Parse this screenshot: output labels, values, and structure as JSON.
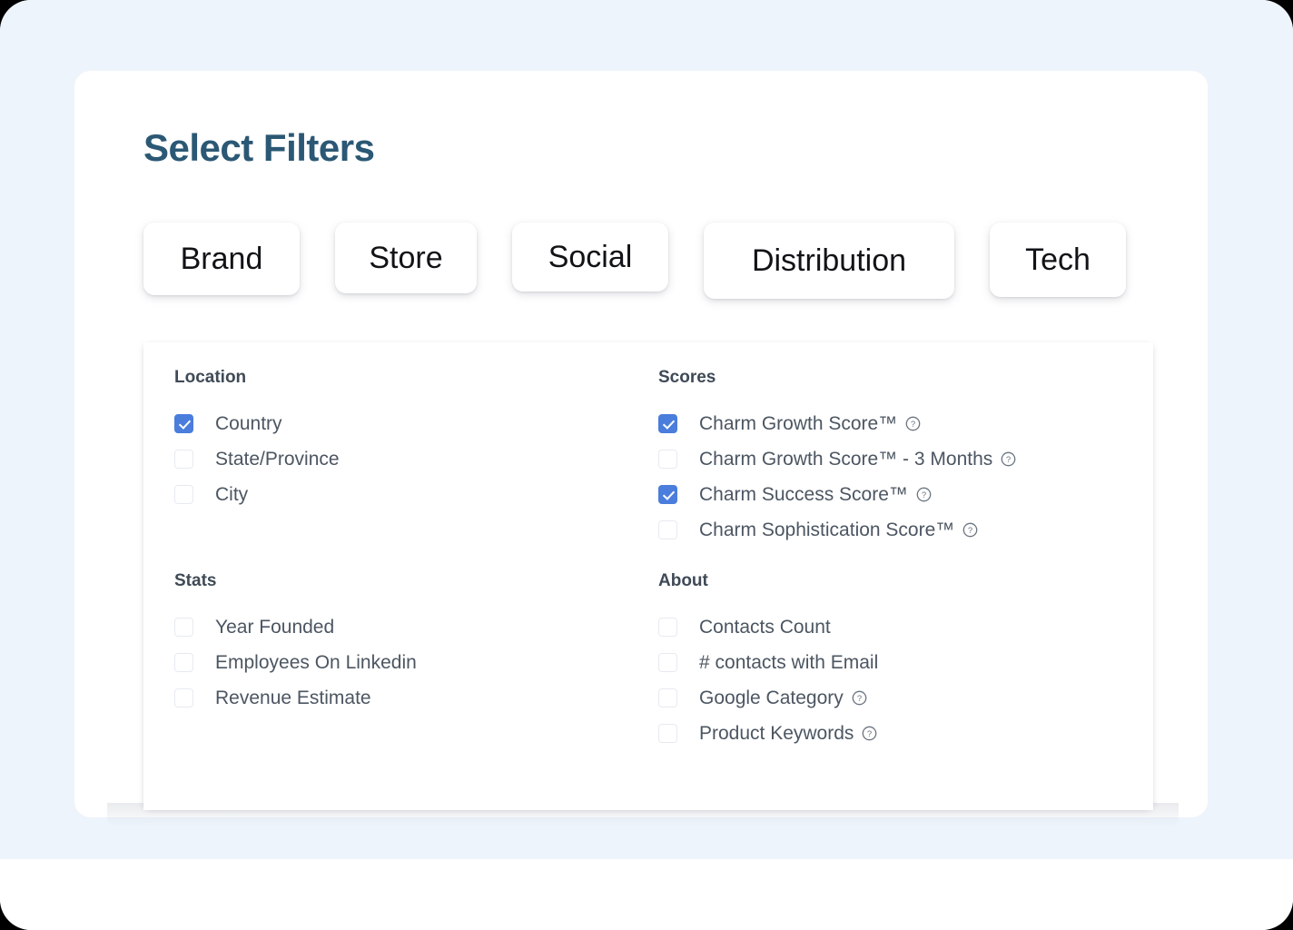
{
  "page": {
    "title": "Select Filters",
    "accent_color": "#2b5874",
    "checkbox_checked_color": "#4a7ddc",
    "background_color": "#eef4fc",
    "card_color": "#ffffff"
  },
  "tabs": [
    {
      "label": "Brand",
      "key": "brand"
    },
    {
      "label": "Store",
      "key": "store"
    },
    {
      "label": "Social",
      "key": "social"
    },
    {
      "label": "Distribution",
      "key": "distribution"
    },
    {
      "label": "Tech",
      "key": "tech"
    }
  ],
  "groups": {
    "location": {
      "title": "Location",
      "options": [
        {
          "label": "Country",
          "checked": true,
          "help": false
        },
        {
          "label": "State/Province",
          "checked": false,
          "help": false
        },
        {
          "label": "City",
          "checked": false,
          "help": false
        }
      ]
    },
    "scores": {
      "title": "Scores",
      "options": [
        {
          "label": "Charm Growth Score™",
          "checked": true,
          "help": true
        },
        {
          "label": "Charm Growth Score™ - 3 Months",
          "checked": false,
          "help": true
        },
        {
          "label": "Charm Success Score™",
          "checked": true,
          "help": true
        },
        {
          "label": "Charm Sophistication Score™",
          "checked": false,
          "help": true
        }
      ]
    },
    "stats": {
      "title": "Stats",
      "options": [
        {
          "label": "Year Founded",
          "checked": false,
          "help": false
        },
        {
          "label": "Employees On Linkedin",
          "checked": false,
          "help": false
        },
        {
          "label": "Revenue Estimate",
          "checked": false,
          "help": false
        }
      ]
    },
    "about": {
      "title": "About",
      "options": [
        {
          "label": "Contacts Count",
          "checked": false,
          "help": false
        },
        {
          "label": "# contacts with Email",
          "checked": false,
          "help": false
        },
        {
          "label": "Google Category",
          "checked": false,
          "help": true
        },
        {
          "label": "Product Keywords",
          "checked": false,
          "help": true
        }
      ]
    }
  },
  "icons": {
    "help": "help-circle-icon",
    "check": "checkmark-icon"
  }
}
